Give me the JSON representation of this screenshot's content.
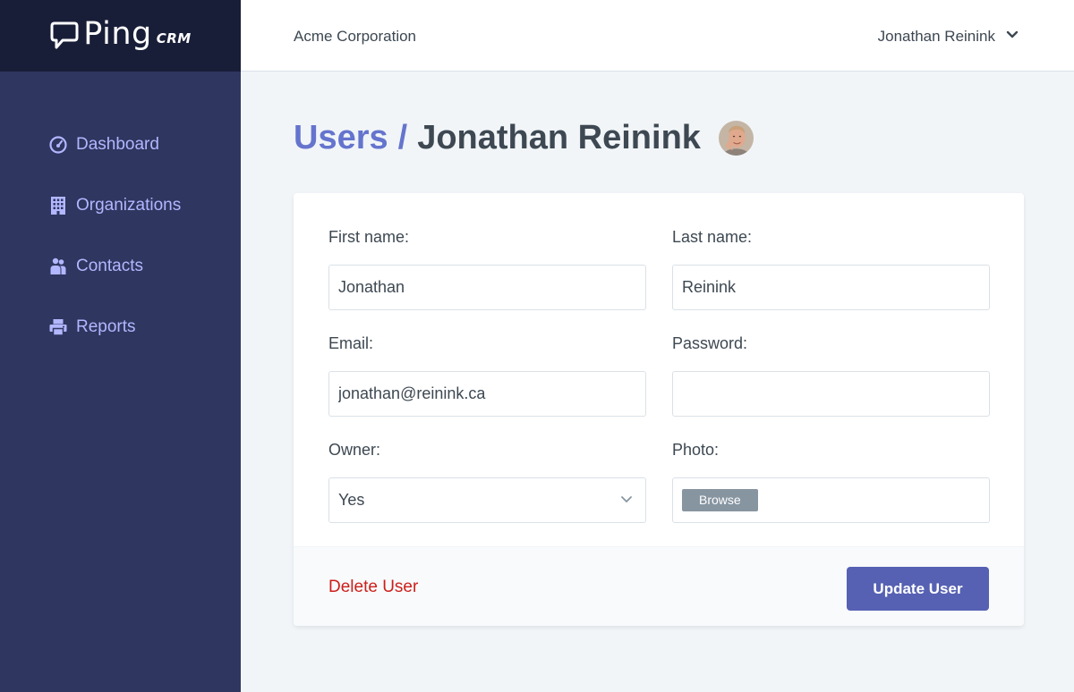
{
  "brand": {
    "logo_word": "Ping",
    "logo_suffix": "CRM",
    "logo_color": "#ffffff"
  },
  "header": {
    "account_name": "Acme Corporation",
    "user_name": "Jonathan Reinink"
  },
  "sidebar": {
    "items": [
      {
        "label": "Dashboard",
        "icon": "dashboard-icon"
      },
      {
        "label": "Organizations",
        "icon": "office-building-icon"
      },
      {
        "label": "Contacts",
        "icon": "users-icon"
      },
      {
        "label": "Reports",
        "icon": "printer-icon"
      }
    ]
  },
  "breadcrumb": {
    "parent": "Users",
    "separator": "/",
    "current": "Jonathan Reinink"
  },
  "form": {
    "first_name": {
      "label": "First name:",
      "value": "Jonathan"
    },
    "last_name": {
      "label": "Last name:",
      "value": "Reinink"
    },
    "email": {
      "label": "Email:",
      "value": "jonathan@reinink.ca"
    },
    "password": {
      "label": "Password:",
      "value": ""
    },
    "owner": {
      "label": "Owner:",
      "selected": "Yes"
    },
    "photo": {
      "label": "Photo:",
      "browse_label": "Browse"
    }
  },
  "actions": {
    "delete_label": "Delete User",
    "update_label": "Update User"
  },
  "colors": {
    "sidebar_bg": "#2f365f",
    "logo_bar_bg": "#191e38",
    "nav_text": "#b2b7ff",
    "accent": "#6574cd",
    "primary_button": "#5661b3",
    "danger": "#cc1f1a",
    "page_bg": "#f1f5f8"
  }
}
